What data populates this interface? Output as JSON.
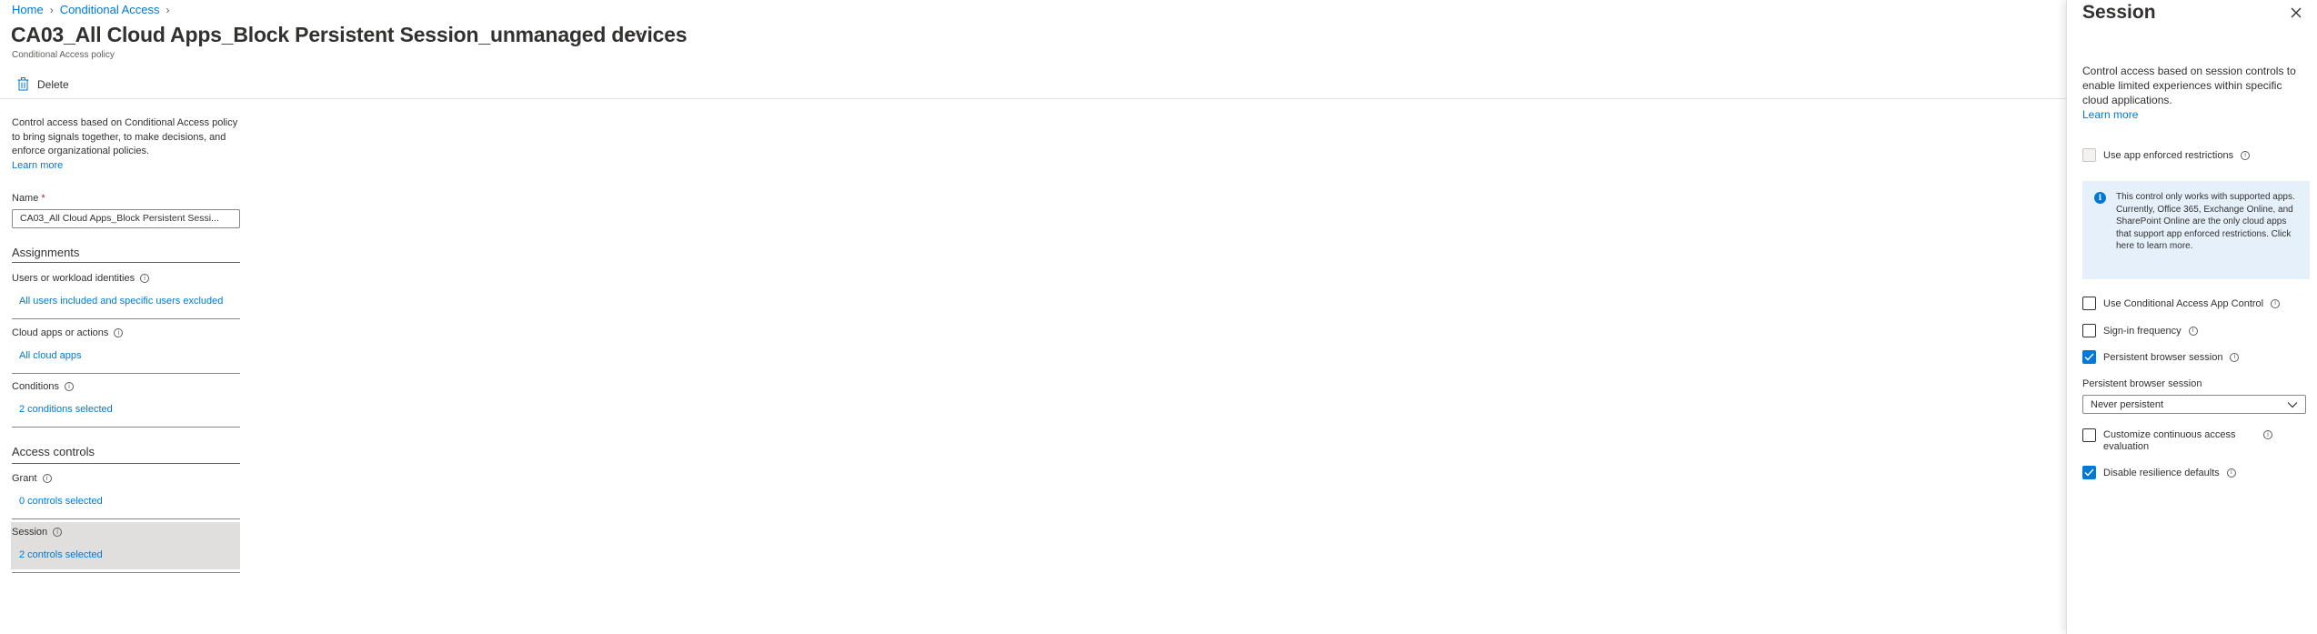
{
  "breadcrumb": {
    "items": [
      "Home",
      "Conditional Access"
    ]
  },
  "page": {
    "title": "CA03_All Cloud Apps_Block Persistent Session_unmanaged devices",
    "more": "···",
    "subtitle": "Conditional Access policy"
  },
  "toolbar": {
    "delete_label": "Delete"
  },
  "description": {
    "text": "Control access based on Conditional Access policy to bring signals together, to make decisions, and enforce organizational policies.",
    "learn_more": "Learn more"
  },
  "name_field": {
    "label": "Name",
    "required": "*",
    "value": "CA03_All Cloud Apps_Block Persistent Sessi..."
  },
  "assignments": {
    "heading": "Assignments",
    "users": {
      "label": "Users or workload identities",
      "value": "All users included and specific users excluded"
    },
    "cloud_apps": {
      "label": "Cloud apps or actions",
      "value": "All cloud apps"
    },
    "conditions": {
      "label": "Conditions",
      "value": "2 conditions selected"
    }
  },
  "access_controls": {
    "heading": "Access controls",
    "grant": {
      "label": "Grant",
      "value": "0 controls selected"
    },
    "session": {
      "label": "Session",
      "value": "2 controls selected"
    }
  },
  "session_panel": {
    "title": "Session",
    "description": "Control access based on session controls to enable limited experiences within specific cloud applications.",
    "learn_more": "Learn more",
    "app_enforced": {
      "label": "Use app enforced restrictions",
      "checked": false,
      "disabled": true
    },
    "info_text": "This control only works with supported apps. Currently, Office 365, Exchange Online, and SharePoint Online are the only cloud apps that support app enforced restrictions. Click here to learn more.",
    "ca_app_control": {
      "label": "Use Conditional Access App Control",
      "checked": false
    },
    "signin_frequency": {
      "label": "Sign-in frequency",
      "checked": false
    },
    "persistent_browser": {
      "label": "Persistent browser session",
      "checked": true
    },
    "persistent_dropdown": {
      "label": "Persistent browser session",
      "value": "Never persistent"
    },
    "continuous_access": {
      "label": "Customize continuous access evaluation",
      "checked": false
    },
    "resilience": {
      "label": "Disable resilience defaults",
      "checked": true
    }
  },
  "colors": {
    "accent": "#0078d4",
    "selected_bg": "#e1dfdd",
    "info_bg": "#e6f0fa"
  }
}
